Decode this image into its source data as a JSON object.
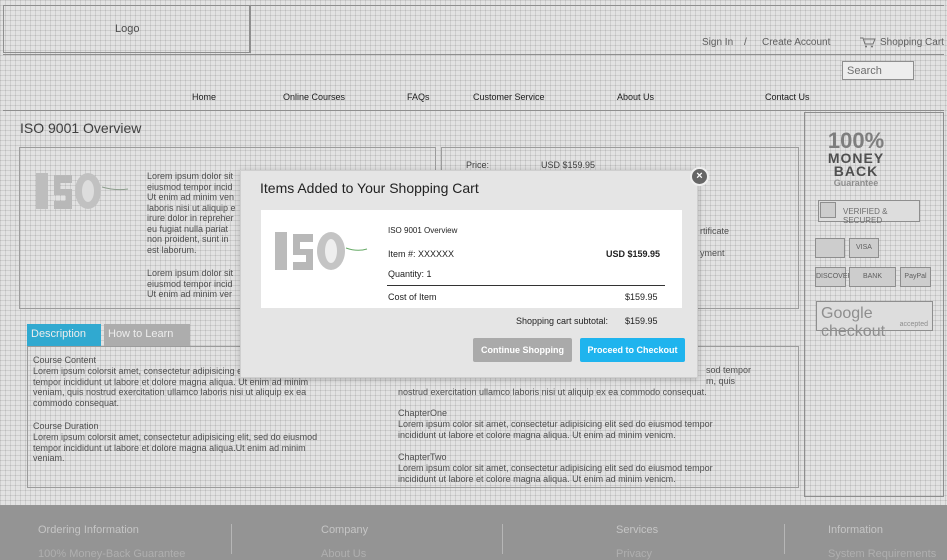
{
  "header": {
    "logo": "Logo",
    "sign_in": "Sign In",
    "separator": "/",
    "create_account": "Create Account",
    "shopping_cart": "Shopping Cart",
    "search_placeholder": "Search"
  },
  "nav": [
    "Home",
    "Online Courses",
    "FAQs",
    "Customer Service",
    "About Us",
    "Contact Us"
  ],
  "page": {
    "title": "ISO 9001 Overview",
    "price_label": "Price:",
    "price_value": "USD $159.95",
    "certificate_partial": "rtificate",
    "payment_partial": "yment",
    "lorem_block_1": "Lorem ipsum dolor sit\neiusmod tempor incid\nUt enim ad minim ven\nlaboris nisi ut aliquip e\nirure dolor in repreher\neu fugiat nulla pariat\nnon proident, sunt in\nest laborum.",
    "lorem_block_2": "Lorem ipsum dolor sit\neiusmod tempor incid\nUt enim ad minim ver",
    "tab_description": "Description",
    "tab_how_to_learn": "How to Learn",
    "course_content_title": "Course Content",
    "course_content_text": "Lorem ipsum colorsit amet, consectetur adipisicing elit, sed do eiusmod\ntempor incididunt ut labore et dolore magna aliqua. Ut enim ad minim\nveniam, quis nostrud exercitation ullamco laboris nisi ut aliquip ex ea\ncommodo consequat.",
    "course_duration_title": "Course Duration",
    "course_duration_text": "Lorem ipsum colorsit amet, consectetur adipisicing elit, sed do eiusmod\ntempor incididunt ut labore et dolore magna aliqua.Ut enim ad minim\nveniam.",
    "right_partial_1": "sod tempor\nm, quis",
    "right_text_1": "nostrud exercitation ullamco laboris nisi ut aliquip ex ea commodo consequat.",
    "chapter_one_title": "ChapterOne",
    "chapter_one_text": "Lorem ipsum color sit amet, consectetur adipisicing elit sed do eiusmod tempor\nincididunt ut labore et colore magna aliqua. Ut enim ad minim venicm.",
    "chapter_two_title": "ChapterTwo",
    "chapter_two_text": "Lorem ipsum color sit amet, consectetur adipisicing elit sed do eiusmod tempor\nincididunt ut labore et colore magna aliqua. Ut enim ad minim venicm."
  },
  "sidebar": {
    "money_line1": "100%",
    "money_line2": "MONEY",
    "money_line3": "BACK",
    "money_line4": "Guarantee",
    "verified": "VERIFIED & SECURED",
    "cards": [
      "VISA",
      "DISCOVER",
      "BANK",
      "PayPal"
    ],
    "google_checkout": "Google checkout",
    "google_accepted": "accepted"
  },
  "footer": {
    "columns": [
      {
        "heading": "Ordering Information",
        "link": "100% Money-Back Guarantee"
      },
      {
        "heading": "Company",
        "link": "About Us"
      },
      {
        "heading": "Services",
        "link": "Privacy"
      },
      {
        "heading": "Information",
        "link": "System Requirements"
      }
    ]
  },
  "modal": {
    "title": "Items Added to Your Shopping Cart",
    "close": "×",
    "item_name": "ISO 9001 Overview",
    "item_number": "Item #: XXXXXX",
    "item_price": "USD $159.95",
    "quantity": "Quantity: 1",
    "cost_label": "Cost of Item",
    "cost_value": "$159.95",
    "subtotal_label": "Shopping cart subtotal:",
    "subtotal_value": "$159.95",
    "continue_label": "Continue Shopping",
    "checkout_label": "Proceed to Checkout"
  }
}
